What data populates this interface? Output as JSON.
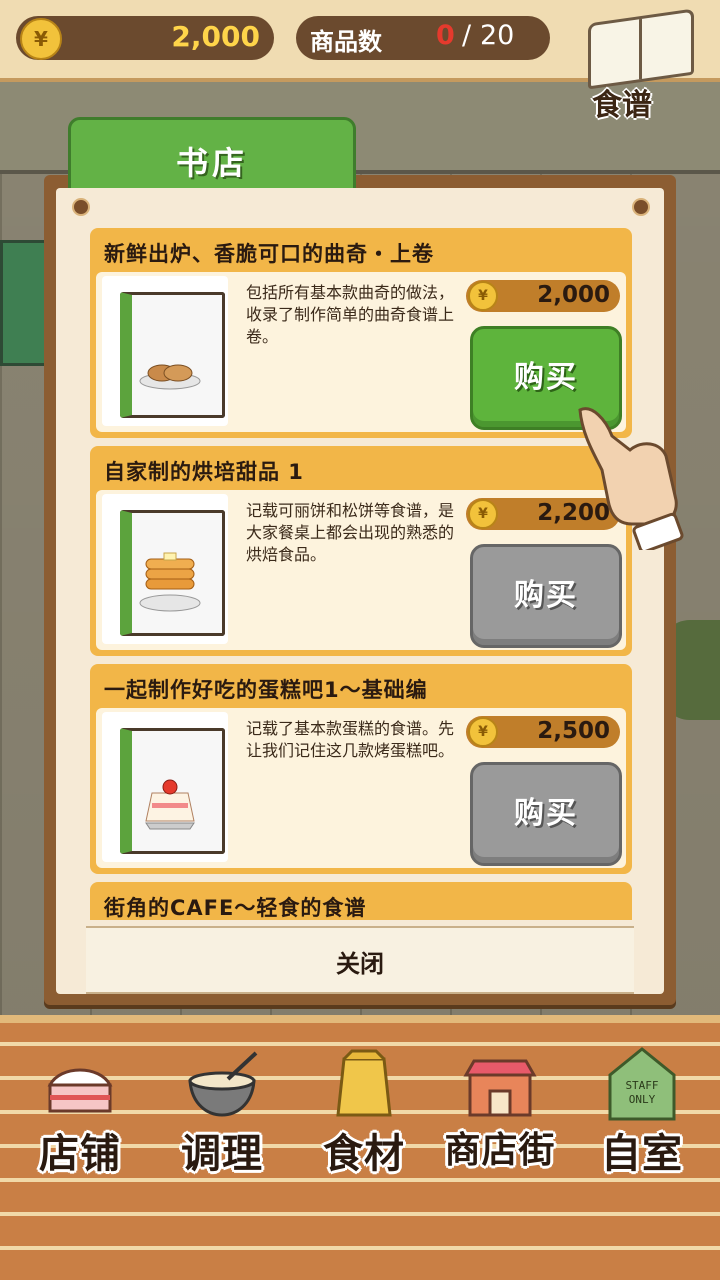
{
  "topbar": {
    "coin_symbol": "¥",
    "coins": "2,000",
    "items_label": "商品数",
    "items_current": "0",
    "items_separator": "/",
    "items_total": "20",
    "recipe_label": "食谱"
  },
  "dialog": {
    "tab_label": "书店",
    "close_label": "关闭",
    "books": [
      {
        "title": "新鲜出炉、香脆可口的曲奇・上卷",
        "desc": "包括所有基本款曲奇的做法，收录了制作简单的曲奇食谱上卷。",
        "price": "2,000",
        "buy_label": "购买",
        "state": "enabled",
        "food": "cookies"
      },
      {
        "title": "自家制的烘培甜品 1",
        "desc": "记载可丽饼和松饼等食谱，是大家餐桌上都会出现的熟悉的烘焙食品。",
        "price": "2,200",
        "buy_label": "购买",
        "state": "disabled",
        "food": "pancakes"
      },
      {
        "title": "一起制作好吃的蛋糕吧1～基础编",
        "desc": "记载了基本款蛋糕的食谱。先让我们记住这几款烤蛋糕吧。",
        "price": "2,500",
        "buy_label": "购买",
        "state": "disabled",
        "food": "strawberry-cake"
      },
      {
        "title": "街角的CAFE～轻食的食谱",
        "desc": "",
        "price": "",
        "buy_label": "",
        "state": "partial"
      }
    ]
  },
  "nav": {
    "items": [
      {
        "label": "店铺",
        "icon": "cake-icon"
      },
      {
        "label": "调理",
        "icon": "mixing-bowl-icon"
      },
      {
        "label": "食材",
        "icon": "flour-bag-icon"
      },
      {
        "label": "商店街",
        "icon": "shop-icon"
      },
      {
        "label": "自室",
        "icon": "staff-door-icon"
      }
    ],
    "staff_sign": "STAFF ONLY"
  },
  "colors": {
    "accent_green": "#5eb43c",
    "disabled_gray": "#9a9a9a",
    "card_orange": "#f2b648",
    "coin_gold": "#f2c23b",
    "counter_red": "#e53a2d"
  }
}
